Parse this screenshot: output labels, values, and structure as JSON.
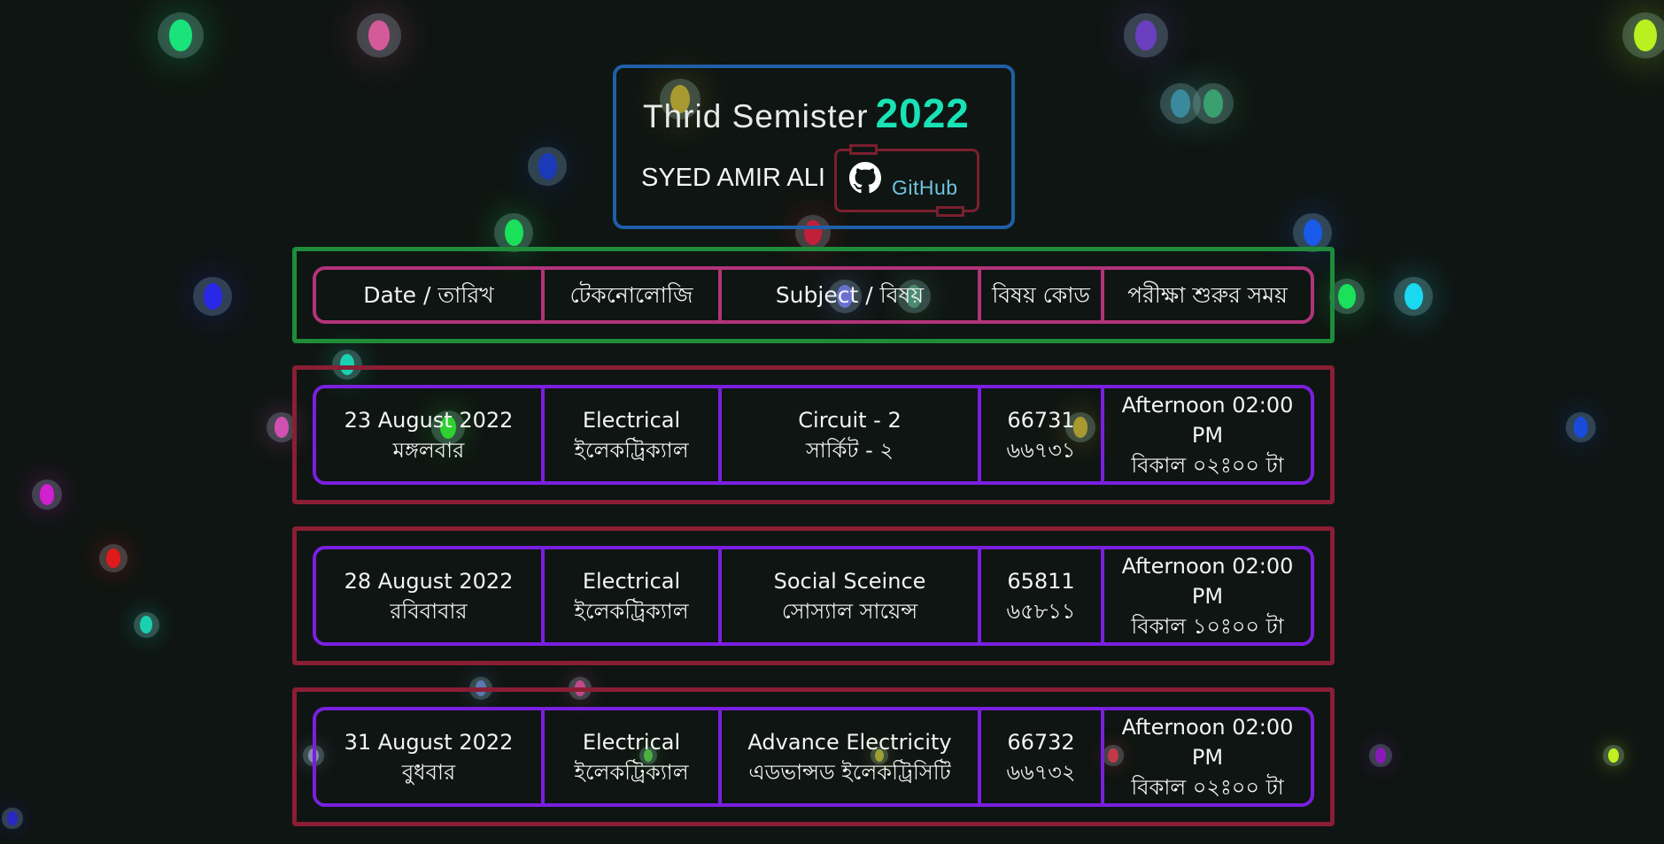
{
  "header": {
    "title": "Thrid Semister",
    "year": "2022",
    "author": "SYED AMIR ALI",
    "github_label": "GitHub"
  },
  "table": {
    "columns": [
      "Date / তারিখ",
      "টেকনোলোজি",
      "Subject / বিষয়",
      "বিষয় কোড",
      "পরীক্ষা শুরুর সময়"
    ],
    "rows": [
      {
        "date_en": "23 August 2022",
        "date_bn": "মঙ্গলবার",
        "tech_en": "Electrical",
        "tech_bn": "ইলেকট্রিক্যাল",
        "subject_en": "Circuit - 2",
        "subject_bn": "সার্কিট - ২",
        "code_en": "66731",
        "code_bn": "৬৬৭৩১",
        "time_en": "Afternoon 02:00 PM",
        "time_bn": "বিকাল ০২ঃ০০ টা"
      },
      {
        "date_en": "28 August 2022",
        "date_bn": "রবিবাবার",
        "tech_en": "Electrical",
        "tech_bn": "ইলেকট্রিক্যাল",
        "subject_en": "Social Sceince",
        "subject_bn": "সোস্যাল সায়েন্স",
        "code_en": "65811",
        "code_bn": "৬৫৮১১",
        "time_en": "Afternoon 02:00 PM",
        "time_bn": "বিকাল ১০ঃ০০ টা"
      },
      {
        "date_en": "31 August 2022",
        "date_bn": "বুধবার",
        "tech_en": "Electrical",
        "tech_bn": "ইলেকট্রিক্যাল",
        "subject_en": "Advance Electricity",
        "subject_bn": "এডভান্সড ইলেকট্রিসিটি",
        "code_en": "66732",
        "code_bn": "৬৬৭৩২",
        "time_en": "Afternoon 02:00 PM",
        "time_bn": "বিকাল ০২ঃ০০ টা"
      }
    ]
  },
  "colors": {
    "background": "#0f1512",
    "accent_year": "#19e3b6",
    "header_border": "#1f5fa8",
    "table_head_outer": "#1e8c3a",
    "table_head_inner": "#b2337a",
    "row_outer": "#8a1e34",
    "row_inner": "#7a1fe0",
    "github_text": "#6fc3df"
  },
  "icons": {
    "github": "github-icon"
  }
}
